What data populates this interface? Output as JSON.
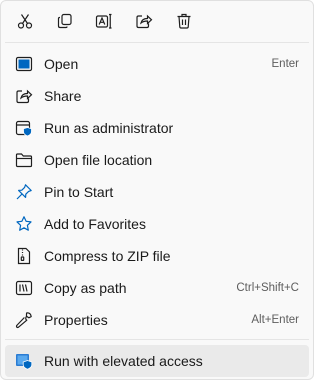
{
  "colors": {
    "accent": "#0067c0",
    "icon_stroke": "#1f1f1f",
    "hover_bg": "#eaeaea",
    "menu_bg": "#f9f9f9"
  },
  "toolbar": {
    "buttons": [
      {
        "name": "cut-icon"
      },
      {
        "name": "copy-icon"
      },
      {
        "name": "rename-icon"
      },
      {
        "name": "share-icon"
      },
      {
        "name": "delete-icon"
      }
    ]
  },
  "menu": {
    "items": [
      {
        "label": "Open",
        "shortcut": "Enter",
        "icon": "open-app-icon"
      },
      {
        "label": "Share",
        "shortcut": "",
        "icon": "share-icon"
      },
      {
        "label": "Run as administrator",
        "shortcut": "",
        "icon": "admin-shield-icon"
      },
      {
        "label": "Open file location",
        "shortcut": "",
        "icon": "folder-icon"
      },
      {
        "label": "Pin to Start",
        "shortcut": "",
        "icon": "pin-icon"
      },
      {
        "label": "Add to Favorites",
        "shortcut": "",
        "icon": "star-icon"
      },
      {
        "label": "Compress to ZIP file",
        "shortcut": "",
        "icon": "zip-icon"
      },
      {
        "label": "Copy as path",
        "shortcut": "Ctrl+Shift+C",
        "icon": "copy-path-icon"
      },
      {
        "label": "Properties",
        "shortcut": "Alt+Enter",
        "icon": "wrench-icon"
      }
    ],
    "extra_item": {
      "label": "Run with elevated access",
      "shortcut": "",
      "icon": "elevated-access-icon"
    }
  }
}
